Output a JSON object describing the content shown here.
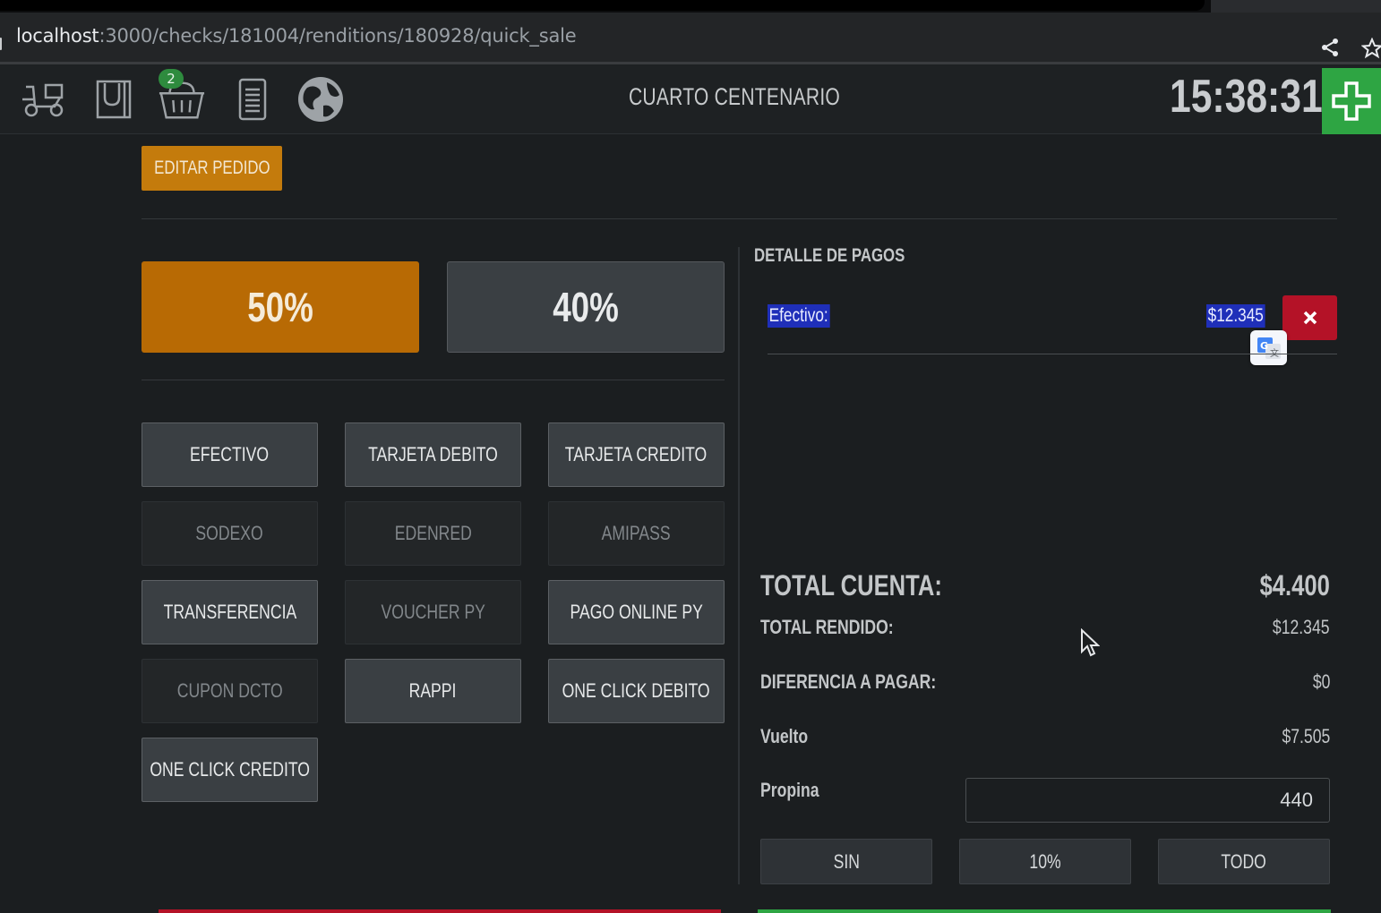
{
  "browser": {
    "url_host": "localhost",
    "url_path": ":3000/checks/181004/renditions/180928/quick_sale"
  },
  "topbar": {
    "icons": [
      "delivery-scooter-icon",
      "bag-icon",
      "basket-icon",
      "receipt-icon",
      "globe-icon"
    ],
    "basket_badge": "2",
    "store_name": "CUARTO CENTENARIO",
    "clock": "15:38:31"
  },
  "actions": {
    "edit_order": "EDITAR PEDIDO"
  },
  "percent_buttons": {
    "selected": "50%",
    "other": "40%"
  },
  "payment_methods": [
    {
      "label": "EFECTIVO",
      "enabled": true
    },
    {
      "label": "TARJETA DEBITO",
      "enabled": true
    },
    {
      "label": "TARJETA CREDITO",
      "enabled": true
    },
    {
      "label": "SODEXO",
      "enabled": false
    },
    {
      "label": "EDENRED",
      "enabled": false
    },
    {
      "label": "AMIPASS",
      "enabled": false
    },
    {
      "label": "TRANSFERENCIA",
      "enabled": true
    },
    {
      "label": "VOUCHER PY",
      "enabled": false
    },
    {
      "label": "PAGO ONLINE PY",
      "enabled": true
    },
    {
      "label": "CUPON DCTO",
      "enabled": false
    },
    {
      "label": "RAPPI",
      "enabled": true
    },
    {
      "label": "ONE CLICK DEBITO",
      "enabled": true
    },
    {
      "label": "ONE CLICK CREDITO",
      "enabled": true
    }
  ],
  "details": {
    "title": "DETALLE DE PAGOS",
    "payments": [
      {
        "label": "Efectivo:",
        "amount": "$12.345"
      }
    ]
  },
  "summary": {
    "total_cuenta_label": "TOTAL CUENTA:",
    "total_cuenta_value": "$4.400",
    "total_rendido_label": "TOTAL RENDIDO:",
    "total_rendido_value": "$12.345",
    "diferencia_label": "DIFERENCIA A PAGAR:",
    "diferencia_value": "$0",
    "vuelto_label": "Vuelto",
    "vuelto_value": "$7.505",
    "propina_label": "Propina",
    "propina_value": "440"
  },
  "tip_buttons": [
    "SIN",
    "10%",
    "TODO"
  ],
  "colors": {
    "accent_orange": "#c47b0c",
    "add_green": "#2ea543",
    "delete_red": "#b41227",
    "selection_blue": "#1f2fb9"
  }
}
